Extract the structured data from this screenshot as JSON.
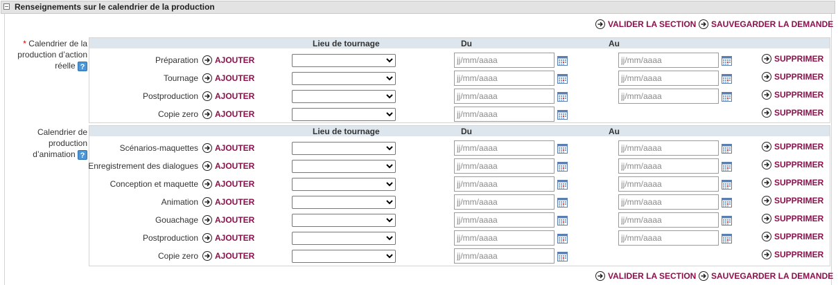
{
  "section": {
    "title": "Renseignements sur le calendrier de la production"
  },
  "actions": {
    "validate": "VALIDER LA SECTION",
    "save": "SAUVEGARDER LA DEMANDE"
  },
  "common": {
    "add": "AJOUTER",
    "delete": "SUPPRIMER",
    "date_placeholder": "jj/mm/aaaa"
  },
  "live_action": {
    "required_mark": "*",
    "label": "Calendrier de la production d’action réelle",
    "help": "?",
    "columns": {
      "location": "Lieu de tournage",
      "from": "Du",
      "to": "Au"
    },
    "rows": [
      {
        "label": "Préparation",
        "has_end": true
      },
      {
        "label": "Tournage",
        "has_end": true
      },
      {
        "label": "Postproduction",
        "has_end": true
      },
      {
        "label": "Copie zero",
        "has_end": false
      }
    ]
  },
  "animation": {
    "label": "Calendrier de production d’animation",
    "help": "?",
    "columns": {
      "location": "Lieu de tournage",
      "from": "Du",
      "to": "Au"
    },
    "rows": [
      {
        "label": "Scénarios-maquettes",
        "has_end": true
      },
      {
        "label": "Enregistrement des dialogues",
        "has_end": true
      },
      {
        "label": "Conception et maquette",
        "has_end": true
      },
      {
        "label": "Animation",
        "has_end": true
      },
      {
        "label": "Gouachage",
        "has_end": true
      },
      {
        "label": "Postproduction",
        "has_end": true
      },
      {
        "label": "Copie zero",
        "has_end": false
      }
    ]
  },
  "colors": {
    "accent": "#8c0f4b",
    "header_bg": "#e3e3e3",
    "table_head_bg": "#dde6ec",
    "required": "#cc0000",
    "help_icon": "#4a96d6"
  }
}
